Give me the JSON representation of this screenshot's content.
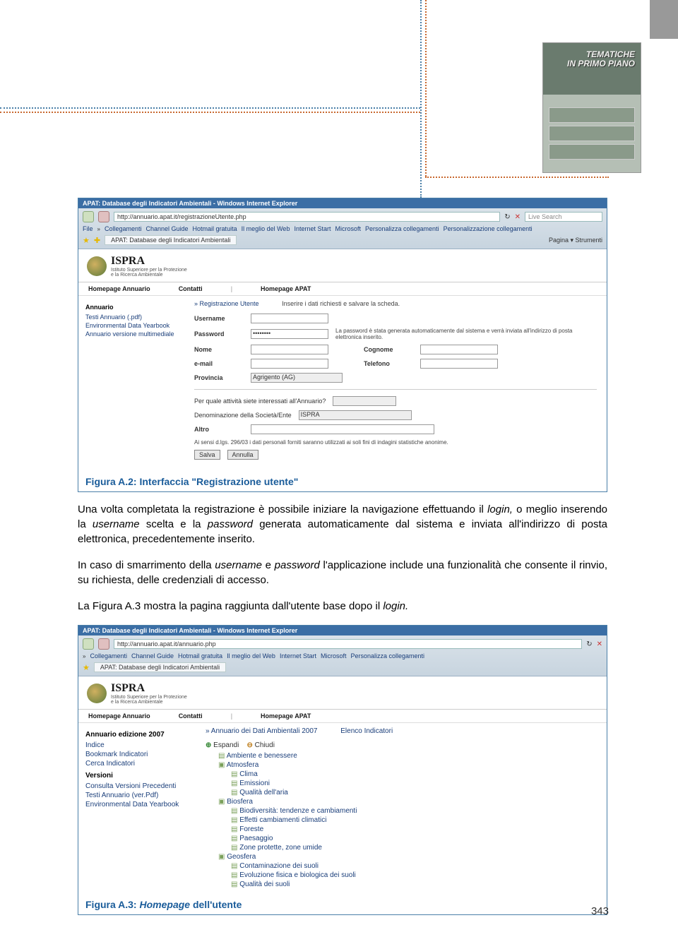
{
  "page_number": "343",
  "top_thumb": {
    "line1": "TEMATICHE",
    "line2": "IN PRIMO PIANO"
  },
  "browser1": {
    "title": "APAT: Database degli Indicatori Ambientali - Windows Internet Explorer",
    "url": "http://annuario.apat.it/registrazioneUtente.php",
    "search_placeholder": "Live Search",
    "menu": [
      "File",
      "Collegamenti",
      "Channel Guide",
      "Hotmail gratuita",
      "Il meglio del Web",
      "Internet Start",
      "Microsoft",
      "Personalizza collegamenti",
      "Personalizzazione collegamenti"
    ],
    "tab": "APAT: Database degli Indicatori Ambientali",
    "toolbar_right": "Pagina ▾   Strumenti"
  },
  "ispra": {
    "name": "ISPRA",
    "sub1": "Istituto Superiore per la Protezione",
    "sub2": "e la Ricerca Ambientale"
  },
  "nav": {
    "a": "Homepage Annuario",
    "b": "Contatti",
    "c": "Homepage APAT"
  },
  "sidenav1": {
    "hd": "Annuario",
    "items": [
      "Testi Annuario (.pdf)",
      "Environmental Data Yearbook",
      "Annuario versione multimediale"
    ]
  },
  "form": {
    "crumb_link": "Registrazione Utente",
    "crumb_text": "Inserire i dati richiesti e salvare la scheda.",
    "username": "Username",
    "password": "Password",
    "password_val": "••••••••",
    "password_help": "La password è stata generata automaticamente dal sistema e verrà inviata all'indirizzo di posta elettronica inserito.",
    "nome": "Nome",
    "cognome": "Cognome",
    "email": "e-mail",
    "telefono": "Telefono",
    "provincia": "Provincia",
    "provincia_val": "Agrigento (AG)",
    "q1": "Per quale attività siete interessati all'Annuario?",
    "q2": "Denominazione della Società/Ente",
    "q2_val": "ISPRA",
    "altro": "Altro",
    "disclaimer": "Ai sensi d.lgs. 296/03 i dati personali forniti saranno utilizzati ai soli fini di indagini statistiche anonime.",
    "save": "Salva",
    "cancel": "Annulla"
  },
  "fig1_caption": {
    "pre": "Figura A.2: Interfaccia \"Registrazione utente\""
  },
  "para1": "Una volta completata la registrazione è possibile iniziare la navigazione effettuando il ",
  "para1_it1": "login,",
  "para1b": " o meglio inserendo la ",
  "para1_it2": "username",
  "para1c": " scelta e la ",
  "para1_it3": "password",
  "para1d": " generata automaticamente dal sistema e inviata all'indirizzo di posta elettronica, precedentemente inserito.",
  "para2a": "In caso di smarrimento della ",
  "para2_it1": "username",
  "para2b": " e ",
  "para2_it2": "password",
  "para2c": " l'applicazione include una funzionalità che consente il rinvio, su richiesta, delle credenziali di accesso.",
  "para3a": "La Figura A.3 mostra la pagina raggiunta dall'utente base dopo il ",
  "para3_it": "login.",
  "browser2": {
    "title": "APAT: Database degli Indicatori Ambientali - Windows Internet Explorer",
    "url": "http://annuario.apat.it/annuario.php",
    "menu": [
      "Collegamenti",
      "Channel Guide",
      "Hotmail gratuita",
      "Il meglio del Web",
      "Internet Start",
      "Microsoft",
      "Personalizza collegamenti"
    ],
    "tab": "APAT: Database degli Indicatori Ambientali"
  },
  "sidenav2": {
    "hd1": "Annuario edizione 2007",
    "items1": [
      "Indice",
      "Bookmark Indicatori",
      "Cerca Indicatori"
    ],
    "hd2": "Versioni",
    "items2": [
      "Consulta Versioni Precedenti",
      "Testi Annuario (ver.Pdf)",
      "Environmental Data Yearbook"
    ]
  },
  "tree": {
    "crumb_a": "Annuario dei Dati Ambientali 2007",
    "crumb_b": "Elenco Indicatori",
    "expand": "Espandi",
    "collapse": "Chiudi",
    "items": [
      "Ambiente e benessere",
      "Atmosfera",
      "  Clima",
      "  Emissioni",
      "  Qualità dell'aria",
      "Biosfera",
      "  Biodiversità: tendenze e cambiamenti",
      "  Effetti cambiamenti climatici",
      "  Foreste",
      "  Paesaggio",
      "  Zone protette, zone umide",
      "Geosfera",
      "  Contaminazione dei suoli",
      "  Evoluzione fisica e biologica dei suoli",
      "  Qualità dei suoli"
    ]
  },
  "fig2_caption": {
    "pre": "Figura A.3: ",
    "em": "Homepage",
    "post": " dell'utente"
  }
}
